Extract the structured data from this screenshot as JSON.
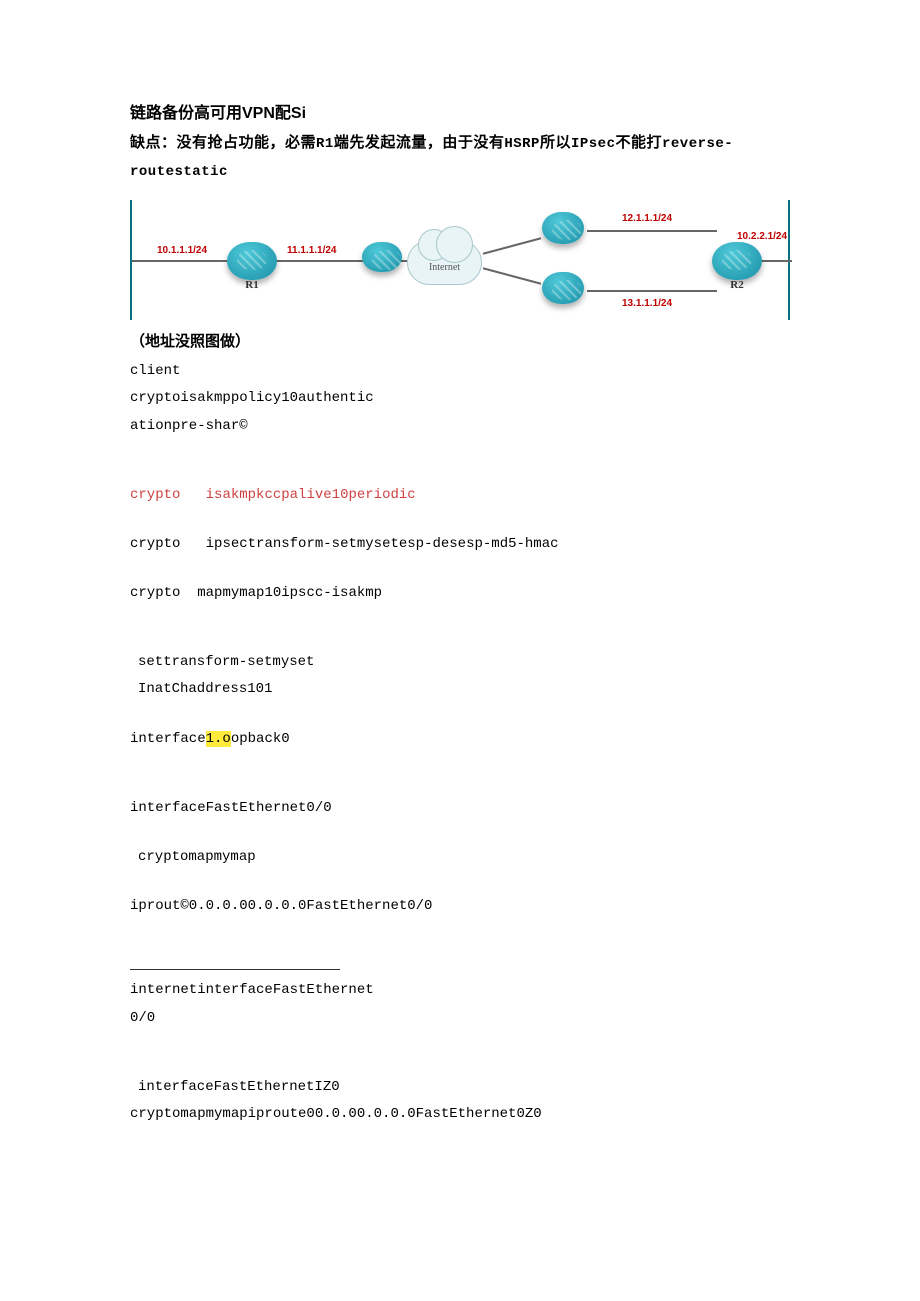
{
  "title": "链路备份高可用VPN配Si",
  "subtitle_prefix": "缺点：没有抢占功能，必需",
  "subtitle_r1": "R1",
  "subtitle_mid": "端先发起流量，由于没有",
  "subtitle_hsrp": "HSRP",
  "subtitle_soyi": "所以",
  "subtitle_ipsec": "IPsec",
  "subtitle_buneng": "不能打",
  "subtitle_reverse": "reverse-routestatic",
  "diagram": {
    "r1": "R1",
    "r2": "R2",
    "internet": "Internet",
    "ip1": "10.1.1.1/24",
    "ip2": "11.1.1.1/24",
    "ip3": "12.1.1.1/24",
    "ip4": "13.1.1.1/24",
    "ip5": "10.2.2.1/24"
  },
  "subheader": "（地址没照图做）",
  "lines": {
    "l1": "client",
    "l2": "cryptoisakmppolicy10authentic",
    "l3": "ationpre-shar©",
    "l4a": "crypto",
    "l4b": "isakmpkccpalive10periodic",
    "l5a": "crypto",
    "l5b": "ipsectransform-setmysetesp-desesp-md5-hmac",
    "l6a": "crypto",
    "l6b": "mapmymap10ipscc-isakmp",
    "l7": "settransform-setmyset",
    "l8": "InatChaddress101",
    "l9a": "interface",
    "l9b": "1.o",
    "l9c": "opback0",
    "l10": "interfaceFastEthernet0/0",
    "l11": "cryptomapmymap",
    "l12": "iprout©0.0.0.00.0.0.0FastEthernet0/0",
    "l13": "internetinterfaceFastEthernet",
    "l14": "0/0",
    "l15": "interfaceFastEthernetIZ0",
    "l16": "cryptomapmymapiproute00.0.00.0.0.0FastEthernet0Z0"
  }
}
